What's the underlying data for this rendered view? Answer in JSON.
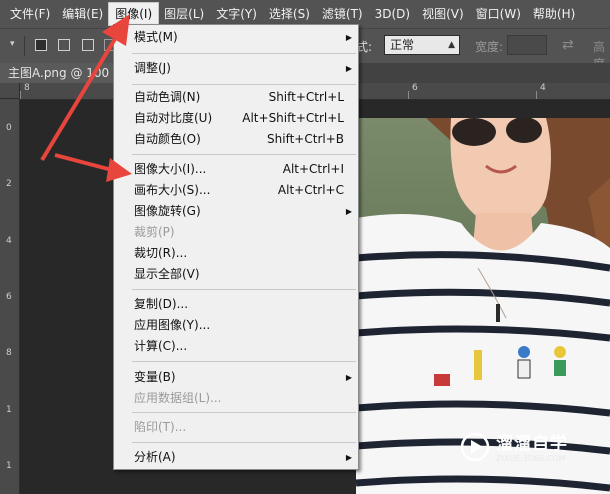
{
  "menubar": {
    "items": [
      {
        "label": "文件(F)"
      },
      {
        "label": "编辑(E)"
      },
      {
        "label": "图像(I)"
      },
      {
        "label": "图层(L)"
      },
      {
        "label": "文字(Y)"
      },
      {
        "label": "选择(S)"
      },
      {
        "label": "滤镜(T)"
      },
      {
        "label": "3D(D)"
      },
      {
        "label": "视图(V)"
      },
      {
        "label": "窗口(W)"
      },
      {
        "label": "帮助(H)"
      }
    ],
    "active_index": 2
  },
  "optionsbar": {
    "mode_label": "式:",
    "mode_value": "正常",
    "width_label": "宽度:",
    "height_label": "高度"
  },
  "document_tab": {
    "title": "主图A.png @ 100"
  },
  "rulers": {
    "top_labels": [
      "8",
      "6",
      "4"
    ],
    "left_labels": [
      "0",
      "2",
      "4",
      "6",
      "8",
      "1",
      "1"
    ]
  },
  "image_menu": {
    "items": [
      {
        "label": "模式(M)",
        "shortcut": "",
        "submenu": true,
        "disabled": false
      },
      {
        "label": "调整(J)",
        "shortcut": "",
        "submenu": true,
        "disabled": false
      },
      {
        "label": "自动色调(N)",
        "shortcut": "Shift+Ctrl+L",
        "submenu": false,
        "disabled": false
      },
      {
        "label": "自动对比度(U)",
        "shortcut": "Alt+Shift+Ctrl+L",
        "submenu": false,
        "disabled": false
      },
      {
        "label": "自动颜色(O)",
        "shortcut": "Shift+Ctrl+B",
        "submenu": false,
        "disabled": false
      },
      {
        "label": "图像大小(I)...",
        "shortcut": "Alt+Ctrl+I",
        "submenu": false,
        "disabled": false
      },
      {
        "label": "画布大小(S)...",
        "shortcut": "Alt+Ctrl+C",
        "submenu": false,
        "disabled": false
      },
      {
        "label": "图像旋转(G)",
        "shortcut": "",
        "submenu": true,
        "disabled": false
      },
      {
        "label": "裁剪(P)",
        "shortcut": "",
        "submenu": false,
        "disabled": true
      },
      {
        "label": "裁切(R)...",
        "shortcut": "",
        "submenu": false,
        "disabled": false
      },
      {
        "label": "显示全部(V)",
        "shortcut": "",
        "submenu": false,
        "disabled": false
      },
      {
        "label": "复制(D)...",
        "shortcut": "",
        "submenu": false,
        "disabled": false
      },
      {
        "label": "应用图像(Y)...",
        "shortcut": "",
        "submenu": false,
        "disabled": false
      },
      {
        "label": "计算(C)...",
        "shortcut": "",
        "submenu": false,
        "disabled": false
      },
      {
        "label": "变量(B)",
        "shortcut": "",
        "submenu": true,
        "disabled": false
      },
      {
        "label": "应用数据组(L)...",
        "shortcut": "",
        "submenu": false,
        "disabled": true
      },
      {
        "label": "陷印(T)...",
        "shortcut": "",
        "submenu": false,
        "disabled": true
      },
      {
        "label": "分析(A)",
        "shortcut": "",
        "submenu": true,
        "disabled": false
      }
    ]
  },
  "watermark": {
    "title": "溜溜自学",
    "subtitle": "ZIXUE.3D66.COM"
  },
  "colors": {
    "annotation_arrow": "#e8453c",
    "menubar_bg": "#535353",
    "menu_bg": "#f0f0f0"
  }
}
